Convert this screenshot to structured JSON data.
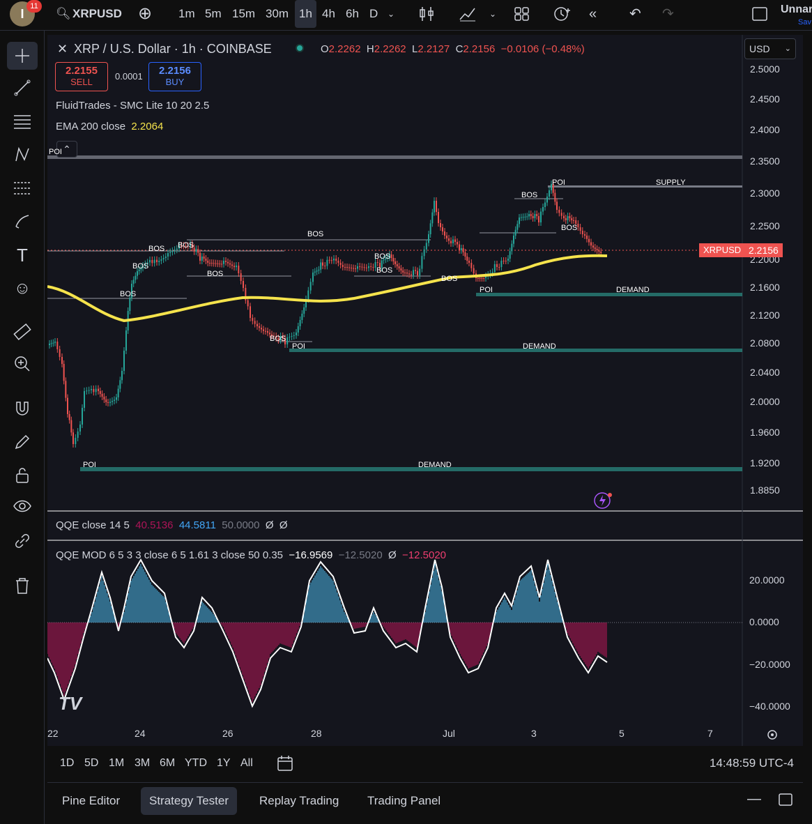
{
  "topbar": {
    "notifications": "11",
    "avatar": "I",
    "symbol": "XRPUSD",
    "timeframes": [
      "1m",
      "5m",
      "15m",
      "30m",
      "1h",
      "4h",
      "6h",
      "D"
    ],
    "active_timeframe": "1h",
    "layout_name": "Unnar",
    "save_label": "Sav"
  },
  "legend": {
    "title": "XRP / U.S. Dollar · 1h · COINBASE",
    "o_label": "O",
    "o": "2.2262",
    "h_label": "H",
    "h": "2.2262",
    "l_label": "L",
    "l": "2.2127",
    "c_label": "C",
    "c": "2.2156",
    "change": "−0.0106 (−0.48%)",
    "sell_price": "2.2155",
    "sell_label": "SELL",
    "spread": "0.0001",
    "buy_price": "2.2156",
    "buy_label": "BUY",
    "indicator1": "FluidTrades - SMC Lite 10 20 2.5",
    "indicator2_name": "EMA 200 close",
    "indicator2_value": "2.2064",
    "currency": "USD"
  },
  "price_axis": {
    "labels": [
      "2.5000",
      "2.4500",
      "2.4000",
      "2.3500",
      "2.3000",
      "2.2500",
      "2.2000",
      "2.1600",
      "2.1200",
      "2.0800",
      "2.0400",
      "2.0000",
      "1.9600",
      "1.9200",
      "1.8850"
    ],
    "tag_symbol": "XRPUSD",
    "tag_price": "2.2156"
  },
  "annotations": {
    "bos": "BOS",
    "poi": "POI",
    "supply": "SUPPLY",
    "demand": "DEMAND"
  },
  "qqe": {
    "name": "QQE close 14 5",
    "v1": "40.5136",
    "v2": "44.5811",
    "v3": "50.0000",
    "v4": "Ø",
    "v5": "Ø"
  },
  "qqe_mod": {
    "name": "QQE MOD 6 5 3 3 close 6 5 1.61 3 close 50 0.35",
    "v1": "−16.9569",
    "v2": "−12.5020",
    "v3": "Ø",
    "v4": "−12.5020",
    "axis": [
      "20.0000",
      "0.0000",
      "−20.0000",
      "−40.0000"
    ]
  },
  "time_axis": [
    "22",
    "24",
    "26",
    "28",
    "Jul",
    "3",
    "5",
    "7"
  ],
  "range_buttons": [
    "1D",
    "5D",
    "1M",
    "3M",
    "6M",
    "YTD",
    "1Y",
    "All"
  ],
  "clock": "14:48:59 UTC-4",
  "panel_tabs": [
    "Pine Editor",
    "Strategy Tester",
    "Replay Trading",
    "Trading Panel"
  ],
  "active_panel_tab": "Strategy Tester",
  "colors": {
    "up": "#26a69a",
    "down": "#ef5350",
    "ema": "#f5e34c",
    "demand": "#2ea59a",
    "buy": "#2962ff",
    "bg": "#14151d"
  }
}
